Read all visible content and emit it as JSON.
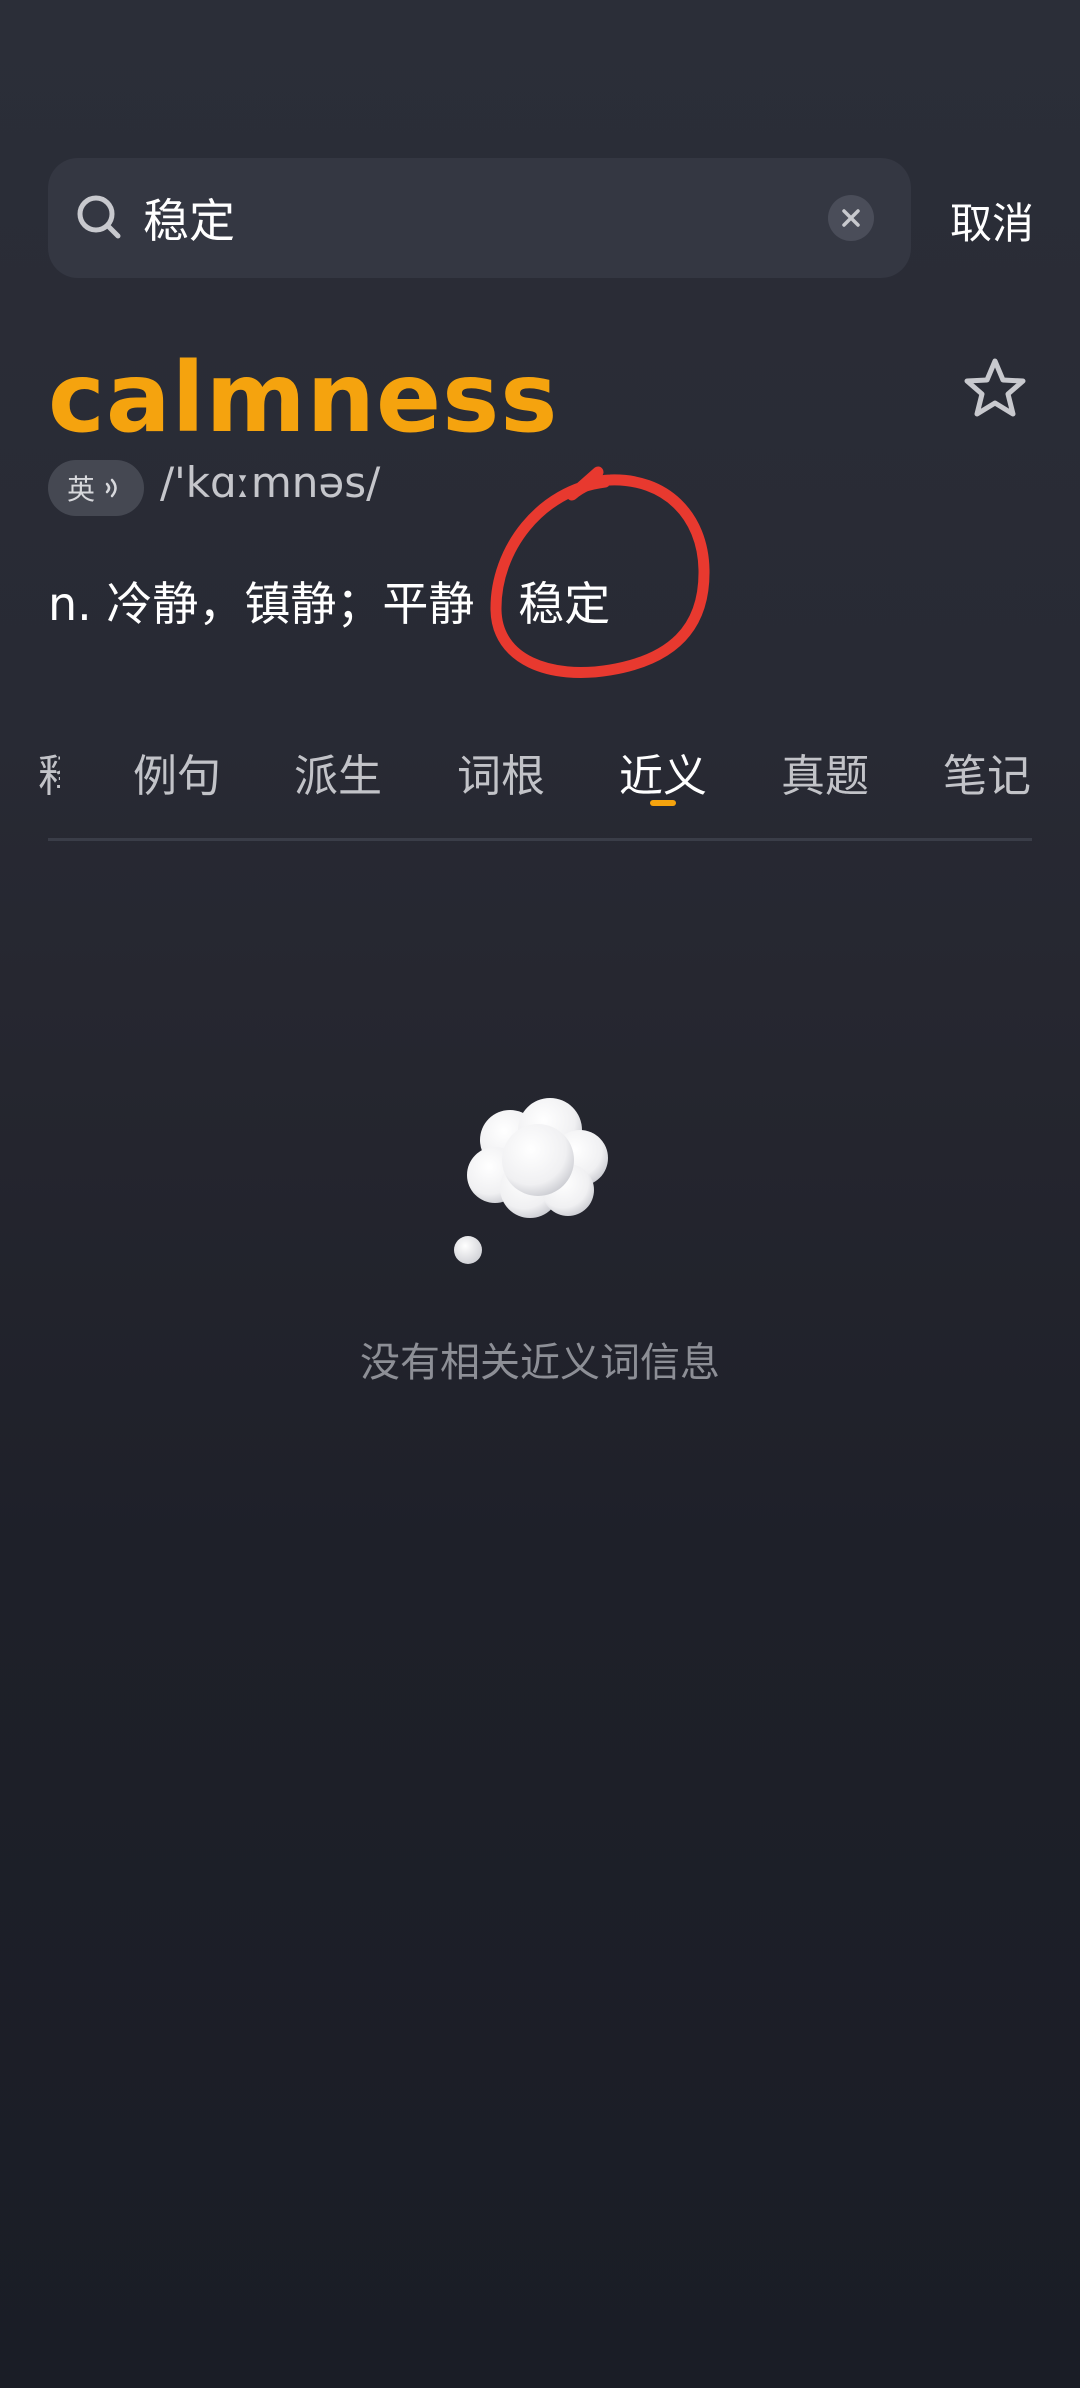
{
  "search": {
    "query": "稳定",
    "cancel_label": "取消"
  },
  "word": {
    "headword": "calmness",
    "accent_label": "英",
    "phonetic": "/'kɑːmnəs/",
    "definition": "n. 冷静，镇静；平静   稳定"
  },
  "tabs": [
    {
      "label": "释"
    },
    {
      "label": "例句"
    },
    {
      "label": "派生"
    },
    {
      "label": "词根"
    },
    {
      "label": "近义"
    },
    {
      "label": "真题"
    },
    {
      "label": "笔记"
    }
  ],
  "active_tab": "近义",
  "empty_state": {
    "message": "没有相关近义词信息"
  },
  "colors": {
    "accent": "#f5a30e",
    "annotation": "#e8392f"
  }
}
